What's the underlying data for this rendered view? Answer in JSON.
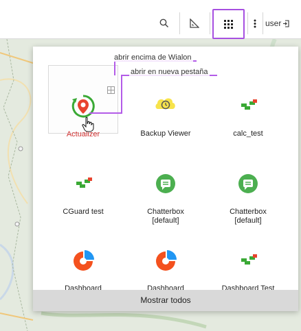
{
  "toolbar": {
    "user_label": "user"
  },
  "icons": {
    "search": "search-icon",
    "ruler": "ruler-icon",
    "apps": "apps-grid-icon",
    "more": "more-vertical-icon",
    "logout": "logout-icon"
  },
  "annotations": {
    "open_over": "abrir encima de Wialon",
    "open_new_tab": "abrir en nueva pestaña"
  },
  "apps": [
    {
      "label": "Actualizer",
      "icon": "actualizer-icon"
    },
    {
      "label": "Backup Viewer",
      "icon": "backup-viewer-icon"
    },
    {
      "label": "calc_test",
      "icon": "calc-test-icon"
    },
    {
      "label": "CGuard test",
      "icon": "cguard-icon"
    },
    {
      "label": "Chatterbox [default]",
      "icon": "chatterbox-icon"
    },
    {
      "label": "Chatterbox [default]",
      "icon": "chatterbox-icon"
    },
    {
      "label": "Dashboard",
      "icon": "dashboard-icon"
    },
    {
      "label": "Dashboard [default]",
      "icon": "dashboard-icon"
    },
    {
      "label": "Dashboard Test",
      "icon": "dashboard-test-icon"
    }
  ],
  "show_all": "Mostrar todos",
  "colors": {
    "accent": "#a64fe0",
    "actualizer_green": "#3aa935",
    "actualizer_red": "#e8432e",
    "chatter_green": "#4caf50",
    "dashboard_orange": "#f4511e",
    "dashboard_blue": "#2196f3"
  }
}
